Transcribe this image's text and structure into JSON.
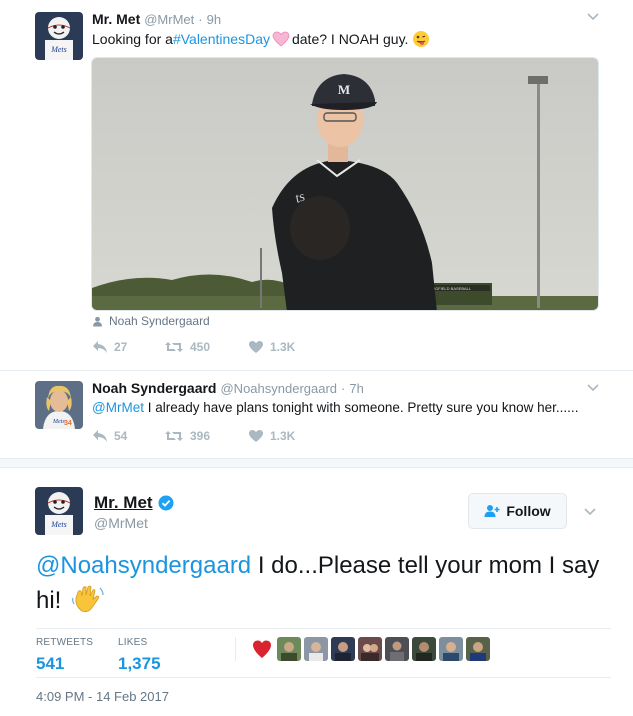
{
  "tweet1": {
    "name": "Mr. Met",
    "handle": "@MrMet",
    "time": "9h",
    "text_prefix": "Looking for a ",
    "hashtag": "#ValentinesDay",
    "text_suffix": " date? I NOAH guy.",
    "photo_tag": "Noah Syndergaard",
    "replies": "27",
    "retweets": "450",
    "likes": "1.3K"
  },
  "tweet2": {
    "name": "Noah Syndergaard",
    "handle": "@Noahsyndergaard",
    "time": "7h",
    "mention": "@MrMet",
    "text": " I already have plans tonight with someone. Pretty sure you know her......",
    "replies": "54",
    "retweets": "396",
    "likes": "1.3K"
  },
  "tweet3": {
    "name": "Mr. Met",
    "handle": "@MrMet",
    "follow_label": "Follow",
    "mention": "@Noahsyndergaard",
    "text": " I do...Please tell your mom I say hi!",
    "retweets_label": "RETWEETS",
    "retweets_value": "541",
    "likes_label": "LIKES",
    "likes_value": "1,375",
    "timestamp": "4:09 PM - 14 Feb 2017"
  },
  "colors": {
    "link": "#1b95e0",
    "muted": "#8899a6",
    "heart_pink": "#f4a6c9",
    "verified": "#1da1f2"
  }
}
